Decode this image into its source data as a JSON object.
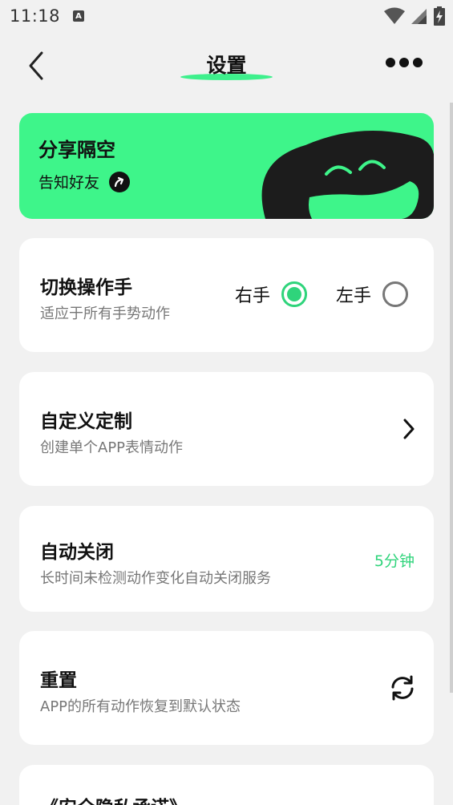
{
  "status_bar": {
    "time": "11:18",
    "badge": "A",
    "icons": [
      "wifi-icon",
      "signal-icon",
      "battery-charging-icon"
    ]
  },
  "nav": {
    "title": "设置",
    "back_icon": "chevron-left-icon",
    "more_icon": "more-dots-icon",
    "accent_color": "#3ef08c"
  },
  "share": {
    "title": "分享隔空",
    "subtitle": "告知好友",
    "arrow_icon": "share-arrow-icon",
    "background": "#3ef58a"
  },
  "hand_switch": {
    "title": "切换操作手",
    "subtitle": "适应于所有手势动作",
    "options": [
      {
        "label": "右手",
        "selected": true
      },
      {
        "label": "左手",
        "selected": false
      }
    ]
  },
  "custom": {
    "title": "自定义定制",
    "subtitle": "创建单个APP表情动作",
    "icon": "chevron-right-icon"
  },
  "auto_close": {
    "title": "自动关闭",
    "subtitle": "长时间未检测动作变化自动关闭服务",
    "value": "5分钟"
  },
  "reset": {
    "title": "重置",
    "subtitle": "APP的所有动作恢复到默认状态",
    "icon": "refresh-icon"
  },
  "privacy": {
    "title": "《安全隐私承诺》"
  }
}
